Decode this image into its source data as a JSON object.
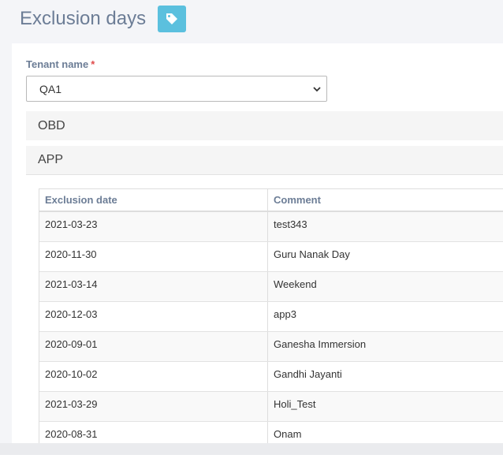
{
  "header": {
    "title": "Exclusion days",
    "tag_icon": "tag-icon"
  },
  "form": {
    "tenant_label": "Tenant name",
    "required_mark": "*",
    "tenant_value": "QA1"
  },
  "accordion": [
    {
      "label": "OBD"
    },
    {
      "label": "APP"
    }
  ],
  "table": {
    "columns": [
      "Exclusion date",
      "Comment"
    ],
    "rows": [
      {
        "date": "2021-03-23",
        "comment": "test343"
      },
      {
        "date": "2020-11-30",
        "comment": "Guru Nanak Day"
      },
      {
        "date": "2021-03-14",
        "comment": "Weekend"
      },
      {
        "date": "2020-12-03",
        "comment": "app3"
      },
      {
        "date": "2020-09-01",
        "comment": "Ganesha Immersion"
      },
      {
        "date": "2020-10-02",
        "comment": "Gandhi Jayanti"
      },
      {
        "date": "2021-03-29",
        "comment": "Holi_Test"
      },
      {
        "date": "2020-08-31",
        "comment": "Onam"
      }
    ]
  },
  "colors": {
    "title": "#6c7d96",
    "tag_button": "#5bc0de",
    "required": "#e04b4b"
  }
}
